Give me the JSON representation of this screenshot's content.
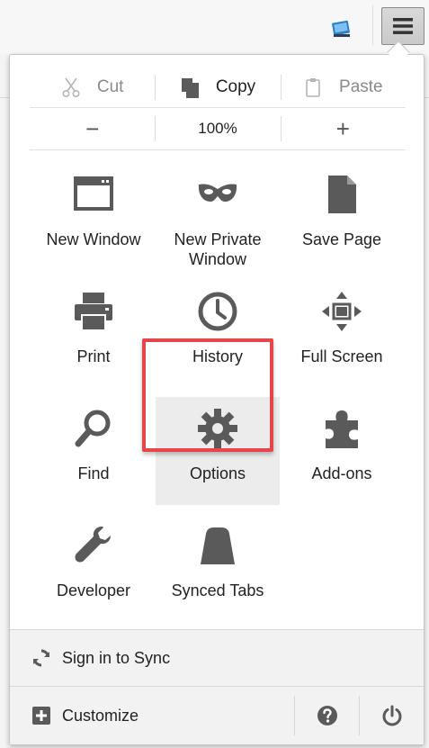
{
  "edit": {
    "cut": "Cut",
    "copy": "Copy",
    "paste": "Paste"
  },
  "zoom": {
    "minus": "−",
    "level": "100%",
    "plus": "+"
  },
  "tiles": {
    "new_window": "New Window",
    "new_private_window_1": "New Private",
    "new_private_window_2": "Window",
    "save_page": "Save Page",
    "print": "Print",
    "history": "History",
    "full_screen": "Full Screen",
    "find": "Find",
    "options": "Options",
    "addons": "Add-ons",
    "developer": "Developer",
    "synced_tabs": "Synced Tabs"
  },
  "footer": {
    "sync": "Sign in to Sync",
    "customize": "Customize"
  },
  "icons": [
    "puzzle-toolbar-icon",
    "hamburger-menu-icon",
    "scissors-icon",
    "copy-icon",
    "clipboard-icon",
    "window-icon",
    "mask-icon",
    "page-icon",
    "printer-icon",
    "clock-icon",
    "fullscreen-arrows-icon",
    "magnifier-icon",
    "gear-icon",
    "puzzle-icon",
    "wrench-icon",
    "synced-tabs-icon",
    "sync-icon",
    "plus-box-icon",
    "help-icon",
    "power-icon"
  ],
  "colors": {
    "icon": "#5a5a5a",
    "highlight_border": "#e8454b",
    "highlight_bg": "#ececec",
    "footer_bg": "#f2f2f2"
  }
}
